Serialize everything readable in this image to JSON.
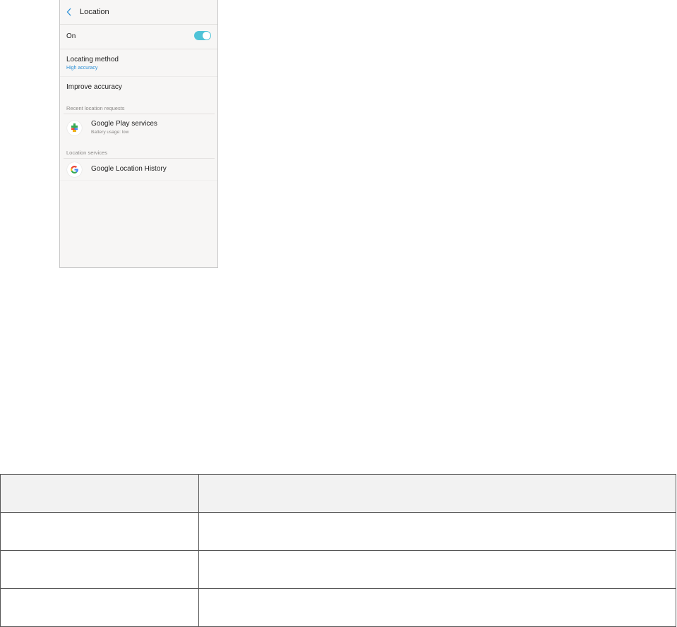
{
  "screen": {
    "title": "Location",
    "master_toggle": {
      "label": "On",
      "state": "on"
    },
    "items": [
      {
        "title": "Locating method",
        "subtitle": "High accuracy"
      },
      {
        "title": "Improve accuracy"
      }
    ],
    "sections": [
      {
        "header": "Recent location requests",
        "apps": [
          {
            "name": "Google Play services",
            "detail": "Battery usage: low",
            "icon": "google-play-services-icon"
          }
        ]
      },
      {
        "header": "Location services",
        "apps": [
          {
            "name": "Google Location History",
            "icon": "google-g-icon"
          }
        ]
      }
    ],
    "colors": {
      "accent": "#4fc3d7",
      "link_blue": "#2a8fd6",
      "background": "#f7f6f5"
    }
  },
  "table": {
    "headers": [
      "",
      ""
    ],
    "rows": [
      [
        "",
        ""
      ],
      [
        "",
        ""
      ],
      [
        "",
        ""
      ]
    ]
  }
}
